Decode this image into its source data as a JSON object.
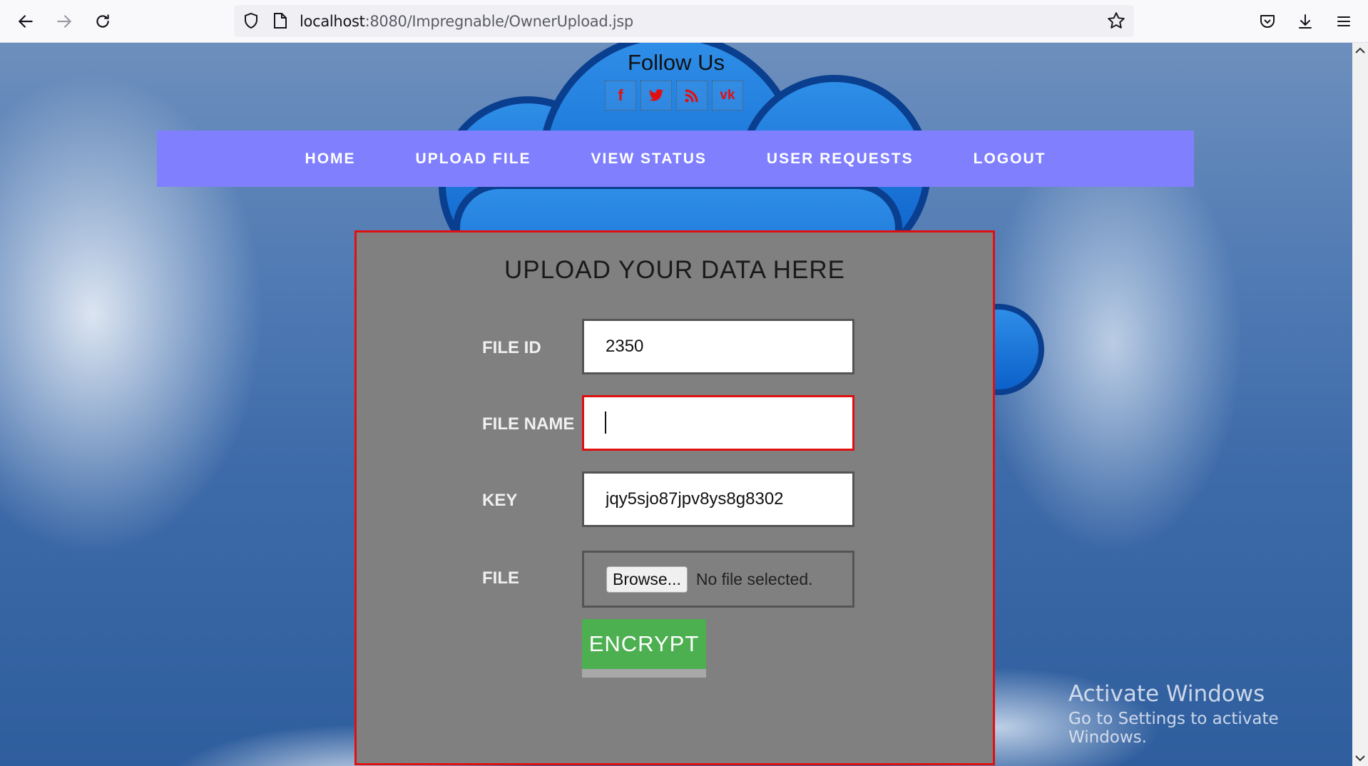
{
  "browser": {
    "url_host": "localhost",
    "url_rest": ":8080/Impregnable/OwnerUpload.jsp"
  },
  "header": {
    "follow_title": "Follow Us",
    "social": [
      {
        "glyph": "f",
        "icon": "facebook-icon"
      },
      {
        "glyph": "🐦",
        "icon": "twitter-icon"
      },
      {
        "glyph": "rss",
        "icon": "rss-icon"
      },
      {
        "glyph": "vk",
        "icon": "vk-icon"
      }
    ]
  },
  "nav": {
    "items": [
      "HOME",
      "UPLOAD FILE",
      "VIEW STATUS",
      "USER REQUESTS",
      "LOGOUT"
    ]
  },
  "form": {
    "title": "UPLOAD YOUR DATA HERE",
    "file_id_label": "FILE ID",
    "file_id_value": "2350",
    "file_name_label": "FILE NAME",
    "file_name_value": "",
    "key_label": "KEY",
    "key_value": "jqy5sjo87jpv8ys8g8302",
    "file_label": "FILE",
    "browse_label": "Browse...",
    "no_file_text": "No file selected.",
    "submit_label": "ENCRYPT"
  },
  "watermark": {
    "line1": "Activate Windows",
    "line2": "Go to Settings to activate Windows."
  },
  "colors": {
    "nav_bg": "#8080ff",
    "panel_bg": "#808080",
    "accent_red": "#e01010",
    "button_green": "#4caf50"
  }
}
